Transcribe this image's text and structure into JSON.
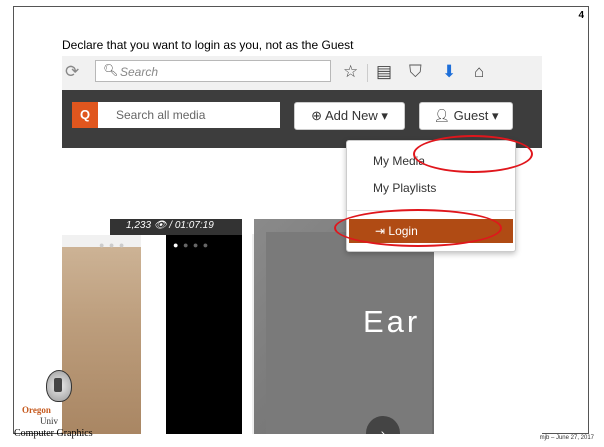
{
  "slide": {
    "page_number": "4",
    "instruction": "Declare that you want to login as you, not as the Guest",
    "footer": "mjb – June 27, 2017",
    "department": "Computer Graphics",
    "university_line1": "Oregon",
    "university_line2": "Univ"
  },
  "browser": {
    "reload_icon": "reload-icon",
    "search_placeholder": "Search",
    "icons": [
      "star-icon",
      "reading-list-icon",
      "pocket-icon",
      "download-icon",
      "home-icon"
    ]
  },
  "site": {
    "search_placeholder": "Search all media",
    "add_new_label": "Add New",
    "guest_label": "Guest",
    "accent_color": "#e0561e",
    "navbar_color": "#3d3d3d"
  },
  "dropdown": {
    "items": [
      "My Media",
      "My Playlists"
    ],
    "login_label": "Login",
    "login_color": "#b04b14"
  },
  "media": {
    "views": "1,233",
    "duration": "01:07:19",
    "thumb_text": "Ear"
  },
  "annotation_color": "#e0161c"
}
